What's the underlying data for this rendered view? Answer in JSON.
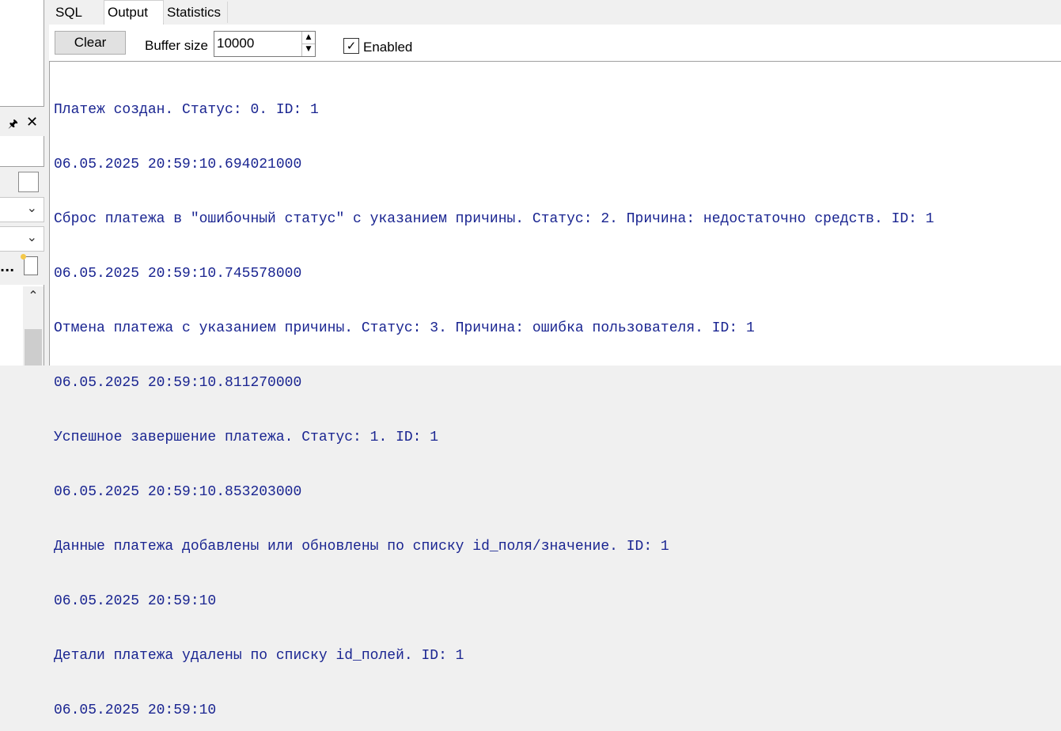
{
  "tabs": [
    {
      "label": "SQL"
    },
    {
      "label": "Output"
    },
    {
      "label": "Statistics"
    }
  ],
  "toolbar": {
    "clear_label": "Clear",
    "buffer_label": "Buffer size",
    "buffer_value": "10000",
    "enabled_label": "Enabled",
    "enabled_checked": true
  },
  "left_panel": {
    "ellipsis": "..."
  },
  "log": [
    "Платеж создан. Статус: 0. ID: 1",
    "06.05.2025 20:59:10.694021000",
    "Сброс платежа в \"ошибочный статус\" с указанием причины. Статус: 2. Причина: недостаточно средств. ID: 1",
    "06.05.2025 20:59:10.745578000",
    "Отмена платежа с указанием причины. Статус: 3. Причина: ошибка пользователя. ID: 1",
    "06.05.2025 20:59:10.811270000",
    "Успешное завершение платежа. Статус: 1. ID: 1",
    "06.05.2025 20:59:10.853203000",
    "Данные платежа добавлены или обновлены по списку id_поля/значение. ID: 1",
    "06.05.2025 20:59:10",
    "Детали платежа удалены по списку id_полей. ID: 1",
    "06.05.2025 20:59:10"
  ],
  "colors": {
    "log_text": "#1a2591",
    "background": "#f0f0f0"
  }
}
